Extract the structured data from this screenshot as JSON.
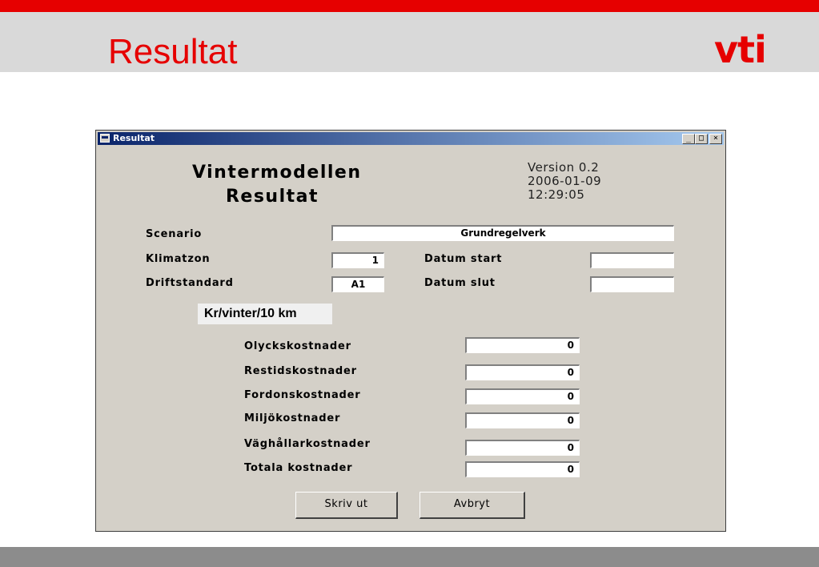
{
  "slide": {
    "title": "Resultat",
    "logo": "vti",
    "accent_color": "#e60000"
  },
  "window": {
    "title": "Resultat",
    "controls": {
      "minimize": "_",
      "maximize": "□",
      "close": "×"
    }
  },
  "app": {
    "title_line1": "Vintermodellen",
    "title_line2": "Resultat",
    "version": "Version 0.2",
    "date": "2006-01-09",
    "time": "12:29:05"
  },
  "form": {
    "scenario_label": "Scenario",
    "scenario_value": "Grundregelverk",
    "klimatzon_label": "Klimatzon",
    "klimatzon_value": "1",
    "datum_start_label": "Datum start",
    "datum_start_value": "",
    "driftstandard_label": "Driftstandard",
    "driftstandard_value": "A1",
    "datum_slut_label": "Datum slut",
    "datum_slut_value": ""
  },
  "costs": {
    "unit_label": "Kr/vinter/10 km",
    "rows": [
      {
        "label": "Olyckskostnader",
        "value": "0"
      },
      {
        "label": "Restidskostnader",
        "value": "0"
      },
      {
        "label": "Fordonskostnader",
        "value": "0"
      },
      {
        "label": "Miljökostnader",
        "value": "0"
      },
      {
        "label": "Väghållarkostnader",
        "value": "0"
      },
      {
        "label": "Totala kostnader",
        "value": "0"
      }
    ]
  },
  "buttons": {
    "print": "Skriv ut",
    "cancel": "Avbryt"
  }
}
